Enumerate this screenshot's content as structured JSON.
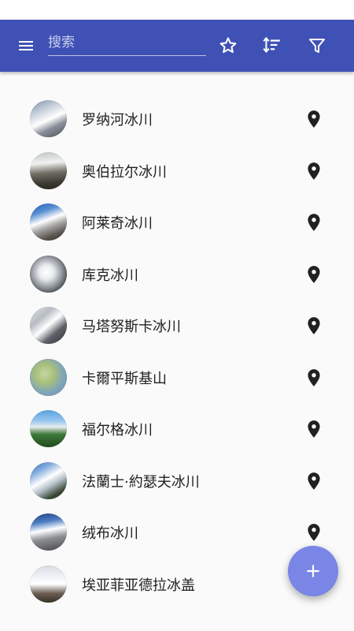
{
  "app": {
    "search_placeholder": "搜索",
    "colors": {
      "primary": "#3f51b5",
      "fab": "#7986e5",
      "text": "#212121",
      "background": "#fafafa"
    },
    "toolbar_icons": [
      "menu-icon",
      "star-outline-icon",
      "sort-icon",
      "filter-icon"
    ]
  },
  "list": {
    "items": [
      {
        "name": "罗纳河冰川",
        "icon": "map-pin-icon"
      },
      {
        "name": "奥伯拉尔冰川",
        "icon": "map-pin-icon"
      },
      {
        "name": "阿莱奇冰川",
        "icon": "map-pin-icon"
      },
      {
        "name": "库克冰川",
        "icon": "map-pin-icon"
      },
      {
        "name": "马塔努斯卡冰川",
        "icon": "map-pin-icon"
      },
      {
        "name": "卡爾平斯基山",
        "icon": "map-pin-icon"
      },
      {
        "name": "福尔格冰川",
        "icon": "map-pin-icon"
      },
      {
        "name": "法蘭士·約瑟夫冰川",
        "icon": "map-pin-icon"
      },
      {
        "name": "绒布冰川",
        "icon": "map-pin-icon"
      },
      {
        "name": "埃亚菲亚德拉冰盖",
        "icon": null
      }
    ]
  },
  "fab": {
    "icon": "plus-icon"
  }
}
